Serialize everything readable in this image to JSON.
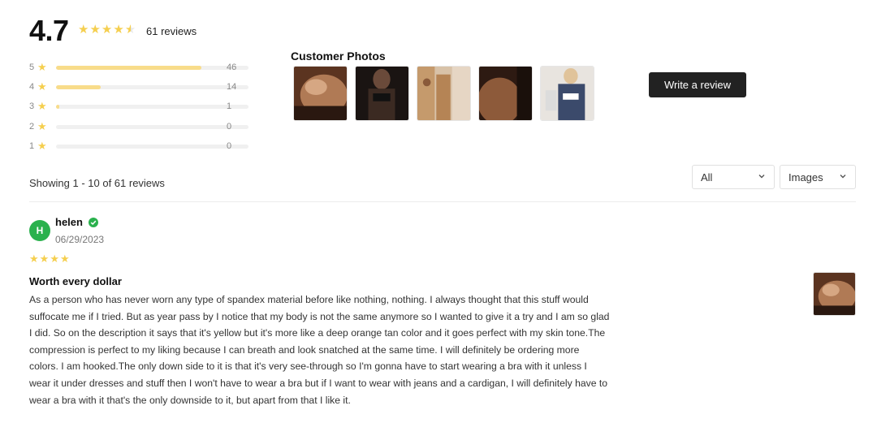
{
  "summary": {
    "rating": "4.7",
    "rating_value": 4.7,
    "review_count_label": "61 reviews"
  },
  "distribution": [
    {
      "stars": "5",
      "count": "46",
      "fraction": 0.754
    },
    {
      "stars": "4",
      "count": "14",
      "fraction": 0.23
    },
    {
      "stars": "3",
      "count": "1",
      "fraction": 0.016
    },
    {
      "stars": "2",
      "count": "0",
      "fraction": 0
    },
    {
      "stars": "1",
      "count": "0",
      "fraction": 0
    }
  ],
  "photos": {
    "title": "Customer Photos",
    "count": 5
  },
  "write_review_label": "Write a review",
  "list": {
    "showing_label": "Showing 1 - 10 of 61 reviews",
    "filter_rating": "All",
    "filter_media": "Images"
  },
  "review": {
    "avatar_initial": "H",
    "name": "helen",
    "date": "06/29/2023",
    "rating": 4,
    "title": "Worth every dollar",
    "body": "As a person who has never worn any type of spandex material before like nothing, nothing. I always thought that this stuff would suffocate me if I tried. But as year pass by I notice that my body is not the same anymore so I wanted to give it a try and I am so glad I did. So on the description it says that it's yellow but it's more like a deep orange tan color and it goes perfect with my skin tone.The compression is perfect to my liking because I can breath and look snatched at the same time. I will definitely be ordering more colors. I am hooked.The only down side to it is that it's very see-through so I'm gonna have to start wearing a bra with it unless I wear it under dresses and stuff then I won't have to wear a bra but if I want to wear with jeans and a cardigan, I will definitely have to wear a bra with it that's the only downside to it, but apart from that I like it."
  },
  "colors": {
    "star": "#f5cf4f",
    "bar_fill": "#f8dc8a",
    "button_bg": "#222222",
    "verified": "#2ab14d",
    "avatar": "#2ab14d"
  }
}
